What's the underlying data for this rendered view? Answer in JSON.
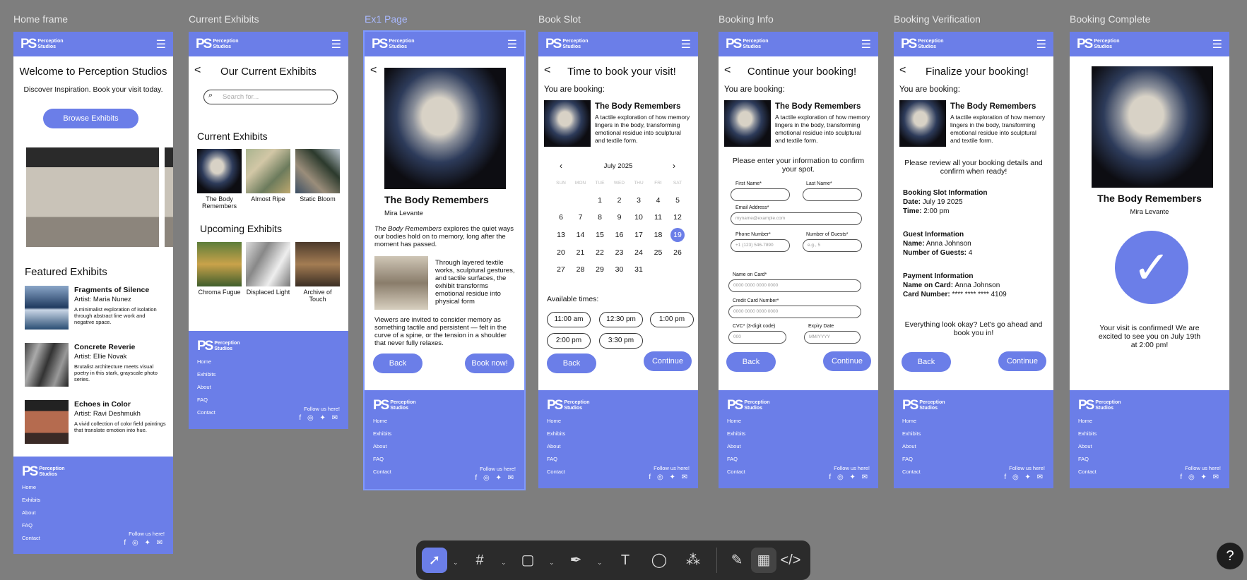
{
  "frame_labels": [
    "Home frame",
    "Current Exhibits",
    "Ex1 Page",
    "Book Slot",
    "Booking Info",
    "Booking Verification",
    "Booking Complete"
  ],
  "brand": {
    "logo": "PS",
    "name_line1": "Perception",
    "name_line2": "Studios"
  },
  "footer": {
    "links": [
      "Home",
      "Exhibits",
      "About",
      "FAQ",
      "Contact"
    ],
    "follow": "Follow us here!"
  },
  "home": {
    "title": "Welcome to Perception Studios",
    "subtitle": "Discover Inspiration. Book your visit today.",
    "browse": "Browse Exhibits",
    "featured_title": "Featured Exhibits",
    "featured": [
      {
        "title": "Fragments of Silence",
        "artist": "Artist: Maria Nunez",
        "desc": "A minimalist exploration of isolation through abstract line work and negative space."
      },
      {
        "title": "Concrete Reverie",
        "artist": "Artist: Ellie Novak",
        "desc": "Brutalist architecture meets visual poetry in this stark, grayscale photo series."
      },
      {
        "title": "Echoes in Color",
        "artist": "Artist: Ravi Deshmukh",
        "desc": "A vivid collection of color field paintings that translate emotion into hue."
      }
    ]
  },
  "current": {
    "title": "Our Current Exhibits",
    "search_placeholder": "Search for...",
    "current_title": "Current Exhibits",
    "current": [
      "The Body Remembers",
      "Almost Ripe",
      "Static Bloom"
    ],
    "upcoming_title": "Upcoming Exhibits",
    "upcoming": [
      "Chroma Fugue",
      "Displaced Light",
      "Archive of Touch"
    ]
  },
  "ex1": {
    "title": "The Body Remembers",
    "artist": "Mira Levante",
    "intro_em": "The Body Remembers",
    "intro": " explores the quiet ways our bodies hold on to memory, long after the moment has passed.",
    "side": "Through layered textile works, sculptural gestures, and tactile surfaces, the exhibit transforms emotional residue into physical form",
    "outro": "Viewers are invited to consider memory as something tactile and persistent — felt in the curve of a spine, or the tension in a shoulder that never fully relaxes.",
    "back": "Back",
    "book": "Book now!"
  },
  "booking_common": {
    "you_are_booking": "You are booking:",
    "exhibit": "The Body Remembers",
    "desc": "A tactile exploration of how memory lingers in the body, transforming emotional residue into sculptural and textile form.",
    "back": "Back",
    "continue": "Continue"
  },
  "slot": {
    "title": "Time to book your visit!",
    "month": "July 2025",
    "dow": [
      "SUN",
      "MON",
      "TUE",
      "WED",
      "THU",
      "FRI",
      "SAT"
    ],
    "weeks": [
      [
        "",
        "",
        "1",
        "2",
        "3",
        "4",
        "5"
      ],
      [
        "6",
        "7",
        "8",
        "9",
        "10",
        "11",
        "12"
      ],
      [
        "13",
        "14",
        "15",
        "16",
        "17",
        "18",
        "19"
      ],
      [
        "20",
        "21",
        "22",
        "23",
        "24",
        "25",
        "26"
      ],
      [
        "27",
        "28",
        "29",
        "30",
        "31",
        "",
        ""
      ]
    ],
    "selected": "19",
    "times_label": "Available times:",
    "times": [
      "11:00 am",
      "12:30 pm",
      "1:00 pm",
      "2:00 pm",
      "3:30 pm"
    ]
  },
  "info": {
    "title": "Continue your booking!",
    "prompt": "Please enter your information to confirm your spot.",
    "fields": {
      "first": "First Name*",
      "last": "Last Name*",
      "email": "Email Address*",
      "email_ph": "myname@example.com",
      "phone": "Phone Number*",
      "phone_ph": "+1 (123) 546-7890",
      "guests": "Number of Guests*",
      "guests_ph": "e.g., 5",
      "card_name": "Name on Card*",
      "card_name_ph": "0000 0000 0000 0000",
      "card_num": "Credit Card Number*",
      "card_num_ph": "0000 0000 0000 0000",
      "cvc": "CVC* (3-digit code)",
      "cvc_ph": "000",
      "exp": "Expiry Date",
      "exp_ph": "MM/YYYY"
    }
  },
  "verify": {
    "title": "Finalize your booking!",
    "prompt": "Please review all your booking details and confirm when ready!",
    "slot_h": "Booking Slot Information",
    "date_l": "Date:",
    "date": " July 19 2025",
    "time_l": "Time:",
    "time": " 2:00 pm",
    "guest_h": "Guest Information",
    "name_l": "Name:",
    "name": " Anna Johnson",
    "guests_l": "Number of Guests:",
    "guests": " 4",
    "pay_h": "Payment Information",
    "card_name_l": "Name on Card:",
    "card_name": " Anna Johnson",
    "card_num_l": "Card Number:",
    "card_num": " **** **** **** 4109",
    "ok": "Everything look okay? Let's go ahead and book you in!"
  },
  "complete": {
    "title": "The Body Remembers",
    "artist": "Mira Levante",
    "msg": "Your visit is confirmed! We are excited to see you on July 19th at 2:00 pm!"
  },
  "toolbar": {
    "tools": [
      "move-tool",
      "frame-tool",
      "shape-tool",
      "pen-tool",
      "text-tool",
      "comment-tool",
      "actions-tool",
      "draw-mode",
      "design-mode",
      "dev-mode"
    ]
  },
  "help": "?",
  "colors": {
    "accent": "#6b7ee8",
    "canvas": "#7e7e7e"
  }
}
